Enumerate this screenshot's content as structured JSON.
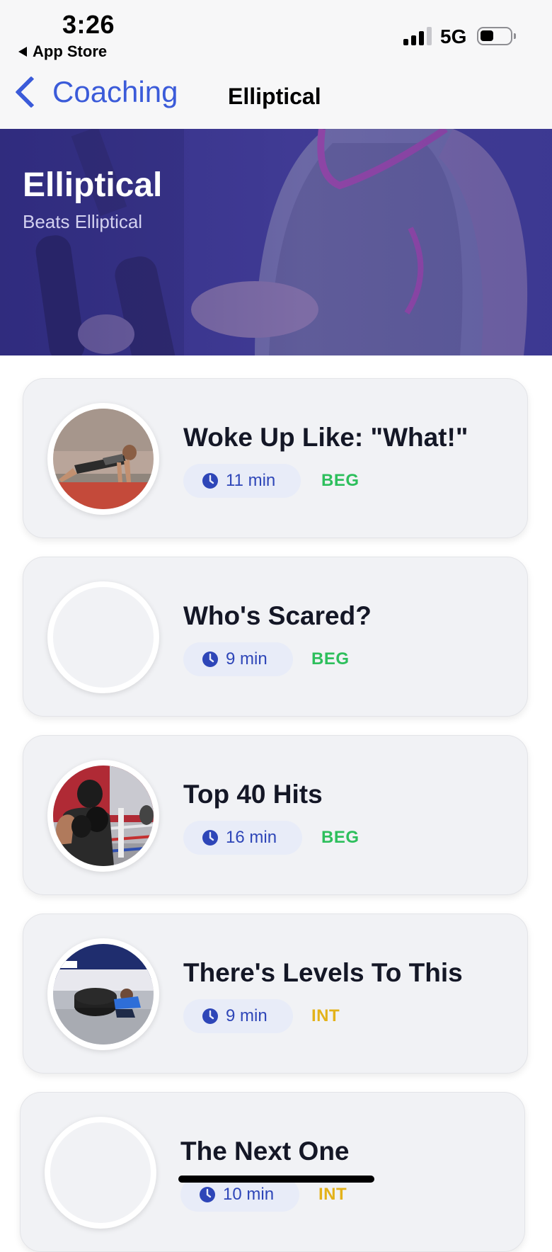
{
  "status_bar": {
    "time": "3:26",
    "back_app": "App Store",
    "network": "5G"
  },
  "nav": {
    "back_label": "Coaching",
    "title": "Elliptical"
  },
  "hero": {
    "title": "Elliptical",
    "subtitle": "Beats Elliptical"
  },
  "colors": {
    "accent": "#3b5bd9",
    "beginner": "#2dbf5c",
    "intermediate": "#e3b21a"
  },
  "workouts": [
    {
      "title": "Woke Up Like: \"What!\"",
      "duration": "11 min",
      "level": "BEG",
      "thumb": "plank-photo"
    },
    {
      "title": "Who's Scared?",
      "duration": "9 min",
      "level": "BEG",
      "thumb": "empty"
    },
    {
      "title": "Top 40 Hits",
      "duration": "16 min",
      "level": "BEG",
      "thumb": "boxing-photo"
    },
    {
      "title": "There's Levels To This",
      "duration": "9 min",
      "level": "INT",
      "thumb": "tire-photo"
    },
    {
      "title": "The Next One",
      "duration": "10 min",
      "level": "INT",
      "thumb": "empty"
    }
  ]
}
